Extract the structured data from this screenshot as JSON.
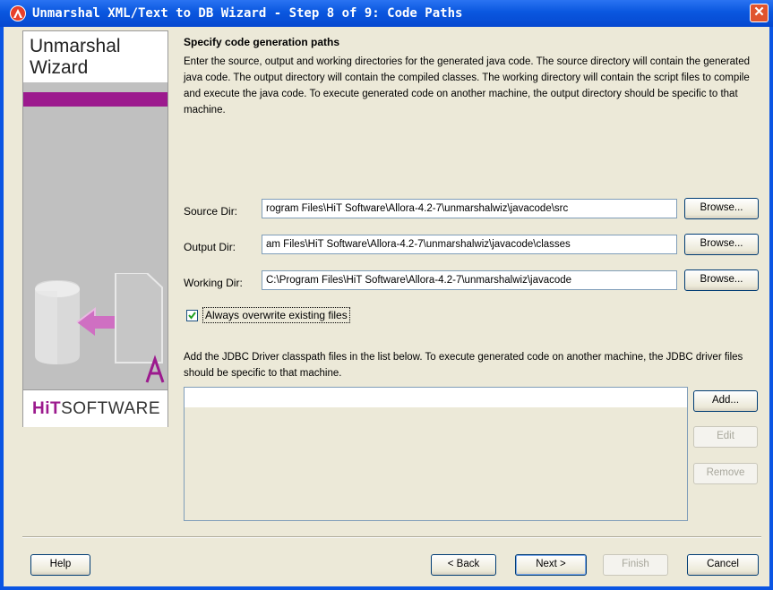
{
  "window": {
    "title": "Unmarshal XML/Text to DB Wizard - Step 8 of 9: Code Paths",
    "close_glyph": "✕"
  },
  "sidebar": {
    "title_line1": "Unmarshal",
    "title_line2": "Wizard",
    "logo_prefix": "HiT",
    "logo_suffix": "SOFTWARE",
    "accent_color": "#9c1a8e"
  },
  "main": {
    "heading": "Specify code generation paths",
    "description": "Enter the source, output and working directories for the generated java code. The source directory will contain the generated java code. The output directory will contain the compiled classes. The working directory will contain the script files to compile and execute the java code. To execute generated code on another machine, the output directory should be specific to that machine.",
    "source_dir": {
      "label": "Source Dir:",
      "value": "rogram Files\\HiT Software\\Allora-4.2-7\\unmarshalwiz\\javacode\\src",
      "browse_label": "Browse..."
    },
    "output_dir": {
      "label": "Output Dir:",
      "value": "am Files\\HiT Software\\Allora-4.2-7\\unmarshalwiz\\javacode\\classes",
      "browse_label": "Browse..."
    },
    "working_dir": {
      "label": "Working Dir:",
      "value": "C:\\Program Files\\HiT Software\\Allora-4.2-7\\unmarshalwiz\\javacode",
      "browse_label": "Browse..."
    },
    "overwrite": {
      "label": "Always overwrite existing files",
      "checked": true
    },
    "jdbc_description": "Add the JDBC Driver classpath files in the list below. To execute generated code on another machine, the JDBC driver files should be specific to that machine.",
    "jdbc_buttons": {
      "add": "Add...",
      "edit": "Edit",
      "remove": "Remove"
    }
  },
  "footer": {
    "help": "Help",
    "back": "< Back",
    "next": "Next >",
    "finish": "Finish",
    "cancel": "Cancel"
  }
}
